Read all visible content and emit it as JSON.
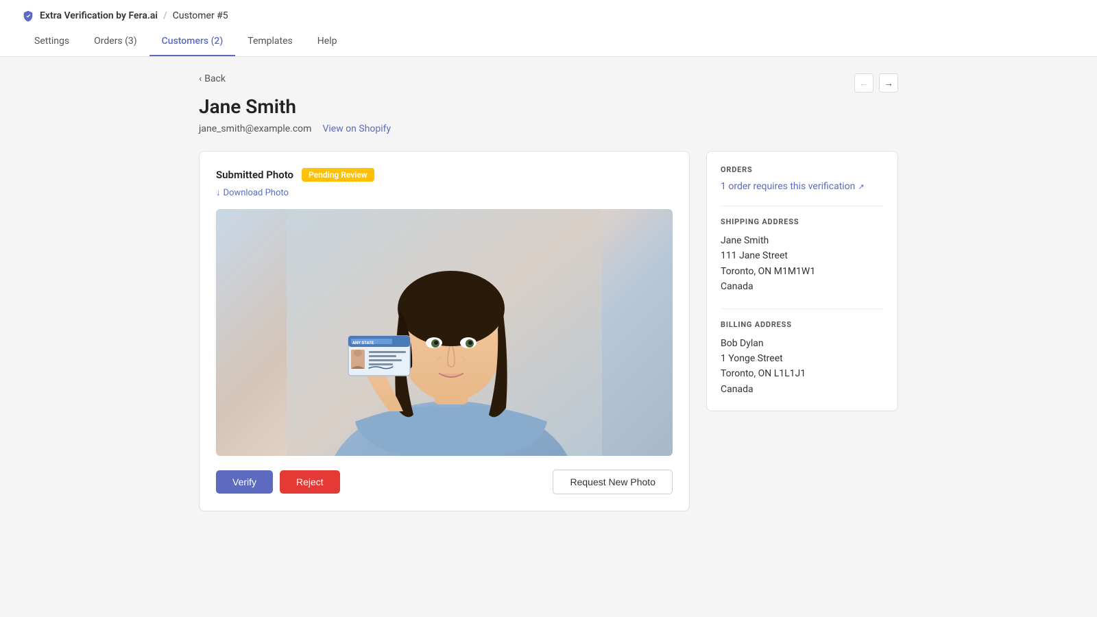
{
  "app": {
    "brand": "Extra Verification by Fera.ai",
    "separator": "/",
    "page": "Customer #5"
  },
  "nav": {
    "tabs": [
      {
        "id": "settings",
        "label": "Settings",
        "active": false
      },
      {
        "id": "orders",
        "label": "Orders (3)",
        "active": false
      },
      {
        "id": "customers",
        "label": "Customers (2)",
        "active": true
      },
      {
        "id": "templates",
        "label": "Templates",
        "active": false
      },
      {
        "id": "help",
        "label": "Help",
        "active": false
      }
    ]
  },
  "breadcrumb": {
    "back_label": "Back"
  },
  "customer": {
    "name": "Jane Smith",
    "email": "jane_smith@example.com",
    "view_shopify_label": "View on Shopify"
  },
  "photo_section": {
    "label": "Submitted Photo",
    "status": "Pending Review",
    "download_label": "Download Photo",
    "verify_btn": "Verify",
    "reject_btn": "Reject",
    "request_btn": "Request New Photo"
  },
  "orders": {
    "title": "ORDERS",
    "link_text": "1 order requires this verification",
    "link_icon": "external-link-icon"
  },
  "shipping": {
    "title": "SHIPPING ADDRESS",
    "name": "Jane Smith",
    "street": "111 Jane Street",
    "city_state": "Toronto, ON M1M1W1",
    "country": "Canada"
  },
  "billing": {
    "title": "BILLING ADDRESS",
    "name": "Bob Dylan",
    "street": "1 Yonge Street",
    "city_state": "Toronto, ON L1L1J1",
    "country": "Canada"
  },
  "colors": {
    "accent": "#5c6bc0",
    "badge_bg": "#ffc107",
    "reject_red": "#e53935"
  }
}
